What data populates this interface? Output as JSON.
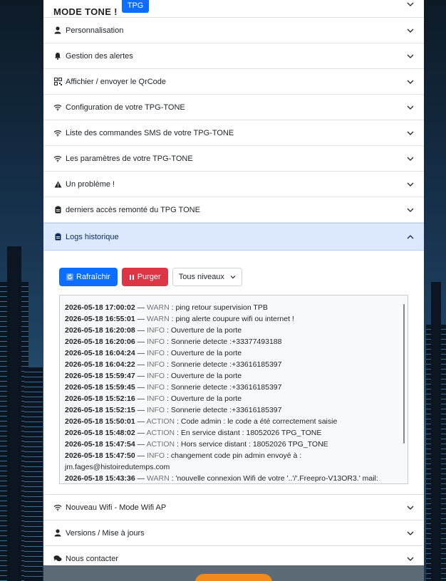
{
  "header": {
    "mode_text": "MODE TONE !",
    "badge": "TPG"
  },
  "sections": [
    {
      "label": "Personnalisation",
      "icon": "person-icon"
    },
    {
      "label": "Gestion des alertes",
      "icon": "bell-icon"
    },
    {
      "label": "Affichier / envoyer le QrCode",
      "icon": "qrcode-icon"
    },
    {
      "label": "Configuration de votre TPG-TONE",
      "icon": "wifi-icon"
    },
    {
      "label": "Liste des commandes SMS de votre TPG-TONE",
      "icon": "wifi-icon"
    },
    {
      "label": "Les paramètres de votre TPG-TONE",
      "icon": "wifi-icon"
    },
    {
      "label": "Un problème !",
      "icon": "warning-icon"
    },
    {
      "label": "derniers accès remonté du TPG TONE",
      "icon": "clipboard-icon"
    }
  ],
  "logs_section": {
    "label": "Logs historique",
    "icon": "clipboard-icon",
    "refresh_label": "Rafraîchir",
    "purge_label": "Purger",
    "level_select": "Tous niveaux",
    "entries": [
      {
        "ts": "2026-05-18 17:00:02",
        "level": "WARN",
        "msg": ": ping retour supervision TPB"
      },
      {
        "ts": "2026-05-18 16:55:01",
        "level": "WARN",
        "msg": ": ping alerte coupure wifi ou internet !"
      },
      {
        "ts": "2026-05-18 16:20:08",
        "level": "INFO",
        "msg": ": Ouverture de la porte"
      },
      {
        "ts": "2026-05-18 16:20:06",
        "level": "INFO",
        "msg": ": Sonnerie detecte :+33377493188"
      },
      {
        "ts": "2026-05-18 16:04:24",
        "level": "INFO",
        "msg": ": Ouverture de la porte"
      },
      {
        "ts": "2026-05-18 16:04:22",
        "level": "INFO",
        "msg": ": Sonnerie detecte :+33616185397"
      },
      {
        "ts": "2026-05-18 15:59:47",
        "level": "INFO",
        "msg": ": Ouverture de la porte"
      },
      {
        "ts": "2026-05-18 15:59:45",
        "level": "INFO",
        "msg": ": Sonnerie detecte :+33616185397"
      },
      {
        "ts": "2026-05-18 15:52:16",
        "level": "INFO",
        "msg": ": Ouverture de la porte"
      },
      {
        "ts": "2026-05-18 15:52:15",
        "level": "INFO",
        "msg": ": Sonnerie detecte :+33616185397"
      },
      {
        "ts": "2026-05-18 15:50:01",
        "level": "ACTION",
        "msg": ": Code admin : le code a été correctement saisie"
      },
      {
        "ts": "2026-05-18 15:48:02",
        "level": "ACTION",
        "msg": ": En service distant : 18052026 TPG_TONE"
      },
      {
        "ts": "2026-05-18 15:47:54",
        "level": "ACTION",
        "msg": ": Hors service distant : 18052026 TPG_TONE"
      },
      {
        "ts": "2026-05-18 15:47:50",
        "level": "INFO",
        "msg": ": changement code pin admin envoyé à :"
      },
      {
        "ts": "",
        "level": "",
        "msg": "jm.fages@histoiredutemps.com"
      },
      {
        "ts": "2026-05-18 15:43:36",
        "level": "WARN",
        "msg": ": 'nouvelle connexion Wifi de votre '..'/'.Freepro-V13OR3.' mail:"
      }
    ]
  },
  "sections_after": [
    {
      "label": "Nouveau Wifi - Mode Wifi AP",
      "icon": "wifi-icon"
    },
    {
      "label": "Versions / Mise à jours",
      "icon": "person-icon"
    },
    {
      "label": "Nous contacter",
      "icon": "chat-icon"
    }
  ],
  "colors": {
    "primary": "#0d6efd",
    "danger": "#dc3545",
    "open_bg": "#dbe8fd"
  }
}
